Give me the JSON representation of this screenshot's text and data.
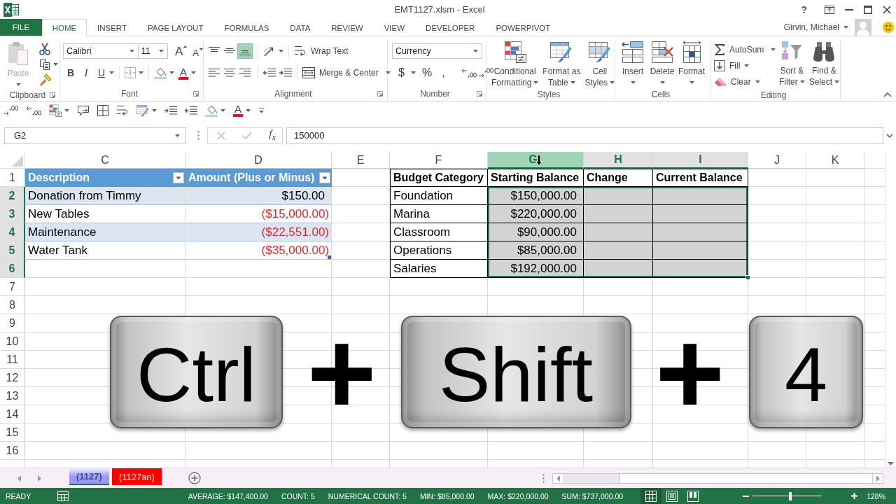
{
  "window": {
    "title": "EMT1127.xlsm - Excel",
    "help": "?"
  },
  "ribbon_tabs": [
    {
      "label": "FILE",
      "kind": "file",
      "selected": false
    },
    {
      "label": "HOME",
      "kind": "tab",
      "selected": true
    },
    {
      "label": "INSERT",
      "kind": "tab",
      "selected": false
    },
    {
      "label": "PAGE LAYOUT",
      "kind": "tab",
      "selected": false
    },
    {
      "label": "FORMULAS",
      "kind": "tab",
      "selected": false
    },
    {
      "label": "DATA",
      "kind": "tab",
      "selected": false
    },
    {
      "label": "REVIEW",
      "kind": "tab",
      "selected": false
    },
    {
      "label": "VIEW",
      "kind": "tab",
      "selected": false
    },
    {
      "label": "DEVELOPER",
      "kind": "tab",
      "selected": false
    },
    {
      "label": "POWERPIVOT",
      "kind": "tab",
      "selected": false
    }
  ],
  "account": {
    "user": "Girvin, Michael"
  },
  "ribbon": {
    "clipboard": {
      "paste": {
        "label": "Paste",
        "disabled": true
      },
      "group_label": "Clipboard"
    },
    "font": {
      "font_name": "Calibri",
      "font_size": "11",
      "grow": "A",
      "shrink": "A",
      "styles": [
        {
          "label": "B",
          "kind": "bold"
        },
        {
          "label": "I",
          "kind": "italic"
        },
        {
          "label": "U",
          "kind": "underline"
        }
      ],
      "font_color": "A",
      "group_label": "Font"
    },
    "alignment": {
      "vertical": [
        {
          "kind": "top",
          "selected": false
        },
        {
          "kind": "middle",
          "selected": false
        },
        {
          "kind": "bottom",
          "selected": true
        }
      ],
      "wrap_text": "Wrap Text",
      "merge": "Merge & Center",
      "group_label": "Alignment"
    },
    "number": {
      "format": "Currency",
      "symbols": [
        {
          "label": "$",
          "kind": "currency"
        },
        {
          "label": "%",
          "kind": "percent"
        },
        {
          "label": ",",
          "kind": "comma"
        }
      ],
      "group_label": "Number"
    },
    "styles": {
      "buttons": [
        {
          "lines": [
            "Conditional",
            "Formatting"
          ],
          "kind": "conditional"
        },
        {
          "lines": [
            "Format as",
            "Table"
          ],
          "kind": "table"
        },
        {
          "lines": [
            "Cell",
            "Styles"
          ],
          "kind": "cell"
        }
      ],
      "group_label": "Styles"
    },
    "cells": {
      "buttons": [
        {
          "label": "Insert",
          "kind": "insert"
        },
        {
          "label": "Delete",
          "kind": "delete"
        },
        {
          "label": "Format",
          "kind": "format"
        }
      ],
      "group_label": "Cells"
    },
    "editing": {
      "small": [
        {
          "label": "AutoSum",
          "kind": "autosum"
        },
        {
          "label": "Fill",
          "kind": "fill"
        },
        {
          "label": "Clear",
          "kind": "clear"
        }
      ],
      "large": [
        {
          "lines": [
            "Sort &",
            "Filter"
          ],
          "kind": "sort"
        },
        {
          "lines": [
            "Find &",
            "Select"
          ],
          "kind": "find"
        }
      ],
      "group_label": "Editing"
    }
  },
  "quick_access": {
    "font_color": "A"
  },
  "formula_bar": {
    "name_box": "G2",
    "function_label": "f$_{x}$",
    "value": "150000"
  },
  "sheet": {
    "columns": [
      {
        "label": "C",
        "selected": false,
        "hovered": false
      },
      {
        "label": "D",
        "selected": false,
        "hovered": false
      },
      {
        "label": "E",
        "selected": false,
        "hovered": false
      },
      {
        "label": "F",
        "selected": false,
        "hovered": false
      },
      {
        "label": "G",
        "selected": true,
        "hovered": true
      },
      {
        "label": "H",
        "selected": true,
        "hovered": false
      },
      {
        "label": "I",
        "selected": true,
        "hovered": false
      },
      {
        "label": "J",
        "selected": false,
        "hovered": false
      },
      {
        "label": "K",
        "selected": false,
        "hovered": false
      }
    ],
    "rows": [
      {
        "label": "1",
        "selected": false
      },
      {
        "label": "2",
        "selected": true
      },
      {
        "label": "3",
        "selected": true
      },
      {
        "label": "4",
        "selected": true
      },
      {
        "label": "5",
        "selected": true
      },
      {
        "label": "6",
        "selected": true
      },
      {
        "label": "7",
        "selected": false
      },
      {
        "label": "8",
        "selected": false
      },
      {
        "label": "9",
        "selected": false
      },
      {
        "label": "10",
        "selected": false
      },
      {
        "label": "11",
        "selected": false
      },
      {
        "label": "12",
        "selected": false
      },
      {
        "label": "13",
        "selected": false
      },
      {
        "label": "14",
        "selected": false
      },
      {
        "label": "15",
        "selected": false
      },
      {
        "label": "16",
        "selected": false
      }
    ]
  },
  "description_table": {
    "headers": [
      {
        "label": "Description",
        "filter": true
      },
      {
        "label": "Amount (Plus or Minus)",
        "filter": true
      }
    ],
    "rows": [
      {
        "description": "Donation from Timmy",
        "amount": "$150.00",
        "negative": false
      },
      {
        "description": "New Tables",
        "amount": "($15,000.00)",
        "negative": true
      },
      {
        "description": "Maintenance",
        "amount": "($22,551.00)",
        "negative": true
      },
      {
        "description": "Water Tank",
        "amount": "($35,000.00)",
        "negative": true
      }
    ]
  },
  "budget_table": {
    "headers": [
      "Budget Category",
      "Starting Balance",
      "Change",
      "Current Balance"
    ],
    "rows": [
      {
        "cells": [
          {
            "text": "Foundation",
            "selected": false
          },
          {
            "text": "$150,000.00",
            "selected": true
          },
          {
            "selected": true
          },
          {
            "selected": true
          }
        ]
      },
      {
        "cells": [
          {
            "text": "Marina",
            "selected": false
          },
          {
            "text": "$220,000.00",
            "selected": true
          },
          {
            "selected": true
          },
          {
            "selected": true
          }
        ]
      },
      {
        "cells": [
          {
            "text": "Classroom",
            "selected": false
          },
          {
            "text": "$90,000.00",
            "selected": true
          },
          {
            "selected": true
          },
          {
            "selected": true
          }
        ]
      },
      {
        "cells": [
          {
            "text": "Operations",
            "selected": false
          },
          {
            "text": "$85,000.00",
            "selected": true
          },
          {
            "selected": true
          },
          {
            "selected": true
          }
        ]
      },
      {
        "cells": [
          {
            "text": "Salaries",
            "selected": false
          },
          {
            "text": "$192,000.00",
            "selected": true
          },
          {
            "selected": true
          },
          {
            "selected": true
          }
        ]
      }
    ]
  },
  "shortcut": [
    {
      "kind": "key",
      "label": "Ctrl"
    },
    {
      "kind": "plus",
      "label": "+"
    },
    {
      "kind": "key",
      "label": "Shift"
    },
    {
      "kind": "plus",
      "label": "+"
    },
    {
      "kind": "key",
      "label": "4"
    }
  ],
  "sheet_tabs": [
    {
      "label": "(1127)",
      "selected": true,
      "color": "#9999ff"
    },
    {
      "label": "(1127an)",
      "selected": false,
      "color": "#ff0000"
    }
  ],
  "status_bar": {
    "mode": "READY",
    "stats": [
      "AVERAGE: $147,400.00",
      "COUNT: 5",
      "NUMERICAL COUNT: 5",
      "MIN: $85,000.00",
      "MAX: $220,000.00",
      "SUM: $737,000.00"
    ],
    "views": [
      {
        "kind": "normal",
        "selected": true
      },
      {
        "kind": "page_layout",
        "selected": false
      },
      {
        "kind": "page_break",
        "selected": false
      }
    ],
    "zoom": {
      "level": 0.55,
      "label": "128%"
    }
  }
}
